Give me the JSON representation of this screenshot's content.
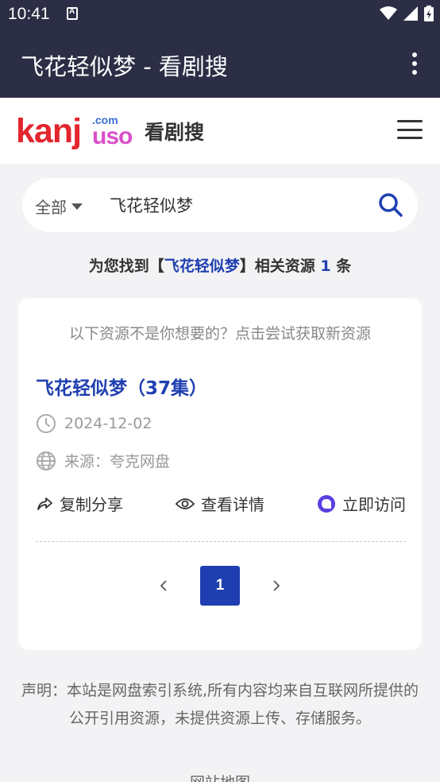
{
  "status": {
    "time": "10:41"
  },
  "appbar": {
    "title": "飞花轻似梦 - 看剧搜"
  },
  "site": {
    "logo_main": "kanj",
    "logo_tail": "uso",
    "logo_com": ".com",
    "name": "看剧搜"
  },
  "search": {
    "scope": "全部",
    "value": "飞花轻似梦"
  },
  "result": {
    "prefix": "为您找到【",
    "keyword": "飞花轻似梦",
    "middle": "】相关资源",
    "count": "1",
    "suffix": "条"
  },
  "card": {
    "tip": "以下资源不是你想要的？点击尝试获取新资源",
    "title": "飞花轻似梦（37集）",
    "date": "2024-12-02",
    "source": "来源：夸克网盘",
    "actions": {
      "share": "复制分享",
      "detail": "查看详情",
      "visit": "立即访问"
    }
  },
  "pager": {
    "current": "1"
  },
  "footer": {
    "disclaimer": "声明：本站是网盘索引系统,所有内容均来自互联网所提供的公开引用资源，未提供资源上传、存储服务。",
    "sitemap": "网站地图"
  },
  "colors": {
    "appbar": "#2c2e45",
    "accent": "#1f3fb0",
    "logo_red": "#e3262e",
    "logo_pink": "#d94fc8",
    "visit_icon": "#5b3fe0"
  },
  "icons": [
    "wifi-icon",
    "signal-icon",
    "battery-icon",
    "more-vert-icon",
    "menu-icon",
    "search-icon",
    "clock-icon",
    "globe-icon",
    "share-icon",
    "eye-icon",
    "visit-icon",
    "chevron-left-icon",
    "chevron-right-icon"
  ]
}
